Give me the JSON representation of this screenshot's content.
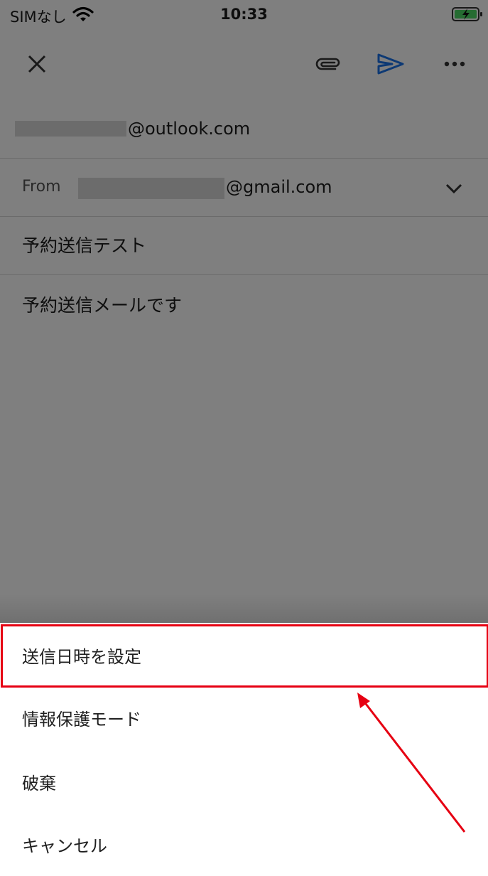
{
  "status_bar": {
    "carrier": "SIMなし",
    "time": "10:33"
  },
  "toolbar": {
    "icons": [
      "close-icon",
      "paperclip-icon",
      "send-icon",
      "more-icon"
    ],
    "send_color": "#1a73e8"
  },
  "compose": {
    "to_domain": "@outlook.com",
    "from_label": "From",
    "from_domain": "@gmail.com",
    "subject": "予約送信テスト",
    "body": "予約送信メールです"
  },
  "menu": {
    "items": [
      {
        "label": "送信日時を設定"
      },
      {
        "label": "情報保護モード"
      },
      {
        "label": "破棄"
      },
      {
        "label": "キャンセル"
      }
    ]
  },
  "annotation": {
    "color": "#e60012"
  }
}
